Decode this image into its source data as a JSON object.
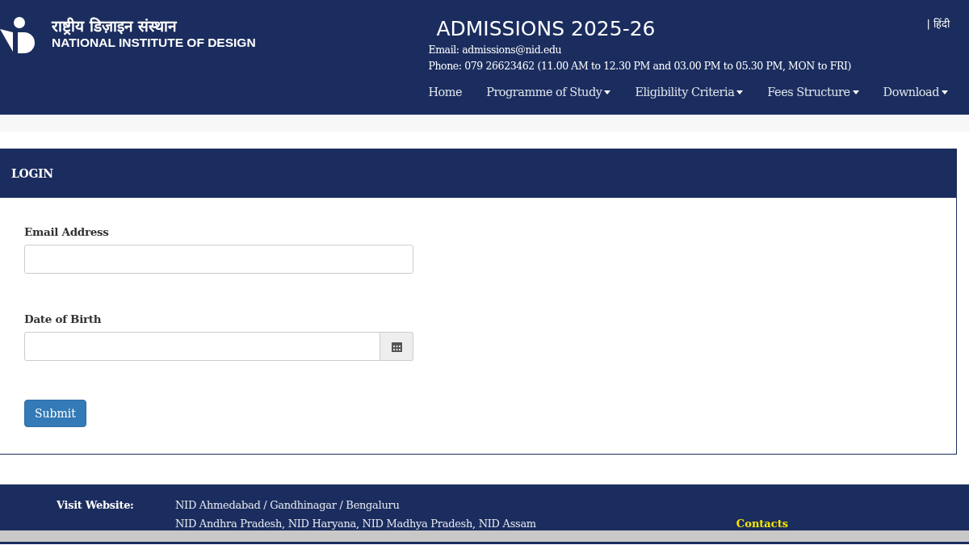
{
  "header": {
    "logo_hindi": "राष्ट्रीय डिज़ाइन संस्थान",
    "logo_english": "NATIONAL INSTITUTE OF DESIGN",
    "title": "ADMISSIONS 2025-26",
    "email": "Email: admissions@nid.edu",
    "phone": "Phone: 079 26623462 (11.00 AM to 12.30 PM and 03.00 PM to 05.30 PM, MON to FRI)",
    "language_link": "| हिंदी",
    "nav": [
      {
        "label": "Home",
        "dropdown": false
      },
      {
        "label": "Programme of Study",
        "dropdown": true
      },
      {
        "label": "Eligibility Criteria",
        "dropdown": true
      },
      {
        "label": "Fees Structure",
        "dropdown": true
      },
      {
        "label": "Download",
        "dropdown": true
      }
    ]
  },
  "login": {
    "title": "LOGIN",
    "fields": [
      {
        "label": "Email Address",
        "kind": "text"
      },
      {
        "label": "Date of Birth",
        "kind": "date"
      }
    ],
    "submit": "Submit"
  },
  "footer": {
    "visit_label": "Visit Website:",
    "links": [
      "NID Ahmedabad / Gandhinagar / Bengaluru",
      "NID Andhra Pradesh, NID Haryana, NID Madhya Pradesh, NID Assam"
    ],
    "contacts": "Contacts"
  }
}
